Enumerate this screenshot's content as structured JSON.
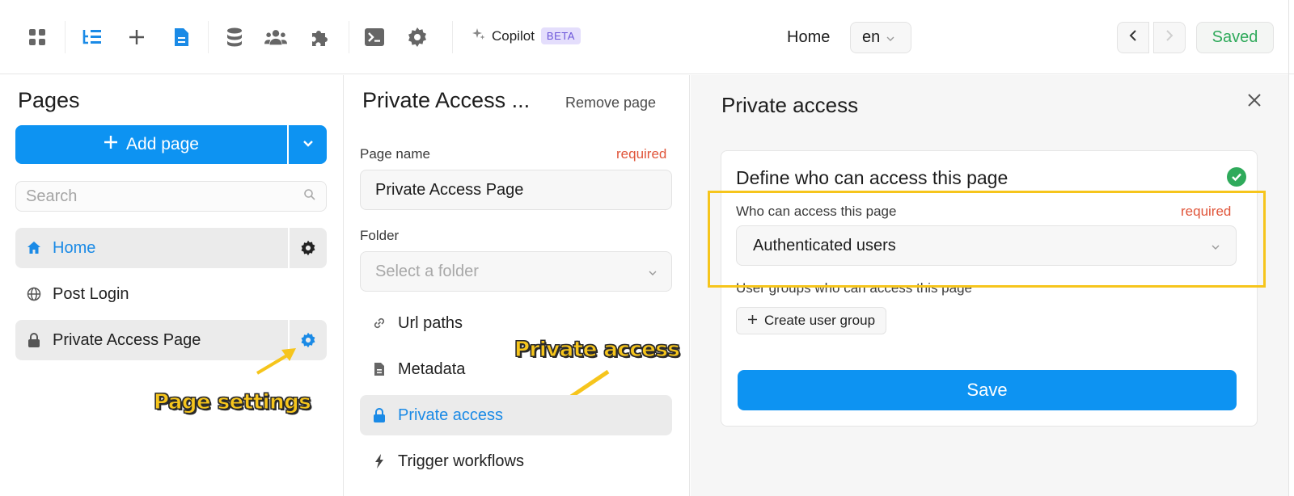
{
  "toolbar": {
    "icons": [
      "apps-icon",
      "page-tree-icon",
      "add-icon",
      "page-icon",
      "database-icon",
      "users-icon",
      "plugins-icon",
      "terminal-icon",
      "settings-icon"
    ],
    "copilot_label": "Copilot",
    "beta_label": "BETA",
    "current_page": "Home",
    "language": "en",
    "saved_label": "Saved",
    "accent_color": "#0d93f2"
  },
  "pages_panel": {
    "title": "Pages",
    "add_page_label": "Add page",
    "search_placeholder": "Search",
    "items": [
      {
        "label": "Home",
        "icon": "home-icon",
        "active": true,
        "has_gear": true
      },
      {
        "label": "Post Login",
        "icon": "globe-icon",
        "active": false,
        "has_gear": false
      },
      {
        "label": "Private Access Page",
        "icon": "lock-icon",
        "active": false,
        "has_gear": true
      }
    ],
    "annotation": "Page settings"
  },
  "page_settings": {
    "title": "Private Access ...",
    "remove_label": "Remove page",
    "page_name_label": "Page name",
    "required_label": "required",
    "page_name_value": "Private Access Page",
    "folder_label": "Folder",
    "folder_placeholder": "Select a folder",
    "menu": [
      {
        "label": "Url paths",
        "icon": "link-icon"
      },
      {
        "label": "Metadata",
        "icon": "document-icon"
      },
      {
        "label": "Private access",
        "icon": "lock-icon",
        "active": true
      },
      {
        "label": "Trigger workflows",
        "icon": "lightning-icon"
      }
    ],
    "annotation": "Private access"
  },
  "private_access": {
    "title": "Private access",
    "card_title": "Define who can access this page",
    "who_label": "Who can access this page",
    "required_label": "required",
    "who_value": "Authenticated users",
    "groups_label": "User groups who can access this page",
    "create_group_label": "Create user group",
    "save_label": "Save",
    "highlight_color": "#f6c51c"
  }
}
